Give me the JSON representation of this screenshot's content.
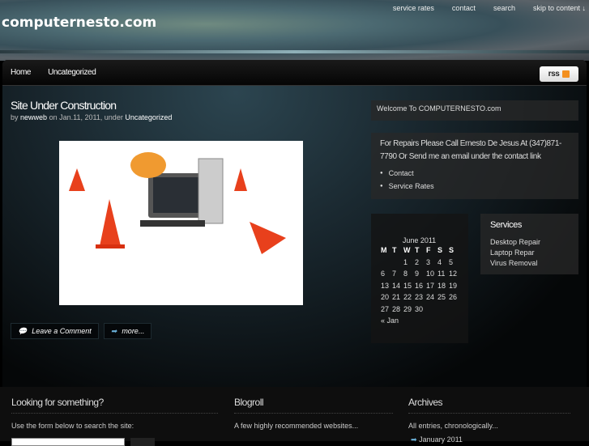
{
  "header": {
    "site_title": "computernesto.com",
    "topnav": [
      "service rates",
      "contact",
      "search",
      "skip to content ↓"
    ]
  },
  "nav": {
    "items": [
      "Home",
      "Uncategorized"
    ],
    "rss": "rss"
  },
  "post": {
    "title": "Site Under Construction",
    "by": "by",
    "author": "newweb",
    "on": "on Jan.11, 2011, under",
    "category": "Uncategorized",
    "leave_comment": "Leave a Comment",
    "more": "more..."
  },
  "sidebar": {
    "welcome": "Welcome To COMPUTERNESTO.com",
    "repairs_text": "For Repairs Please Call Ernesto De Jesus At (347)871-7790 Or Send me an email under the contact link",
    "links": [
      "Contact",
      "Service Rates"
    ],
    "calendar": {
      "caption": "June 2011",
      "headers": [
        "M",
        "T",
        "W",
        "T",
        "F",
        "S",
        "S"
      ],
      "weeks": [
        [
          "",
          "",
          "1",
          "2",
          "3",
          "4",
          "5"
        ],
        [
          "6",
          "7",
          "8",
          "9",
          "10",
          "11",
          "12"
        ],
        [
          "13",
          "14",
          "15",
          "16",
          "17",
          "18",
          "19"
        ],
        [
          "20",
          "21",
          "22",
          "23",
          "24",
          "25",
          "26"
        ],
        [
          "27",
          "28",
          "29",
          "30",
          "",
          "",
          ""
        ]
      ],
      "prev": "« Jan"
    },
    "services": {
      "title": "Services",
      "items": [
        "Desktop Repair",
        "Laptop Repar",
        "Virus Removal"
      ]
    }
  },
  "footer": {
    "search": {
      "title": "Looking for something?",
      "text": "Use the form below to search the site:"
    },
    "blogroll": {
      "title": "Blogroll",
      "text": "A few highly recommended websites..."
    },
    "archives": {
      "title": "Archives",
      "text": "All entries, chronologically...",
      "items": [
        "January 2011"
      ]
    }
  }
}
